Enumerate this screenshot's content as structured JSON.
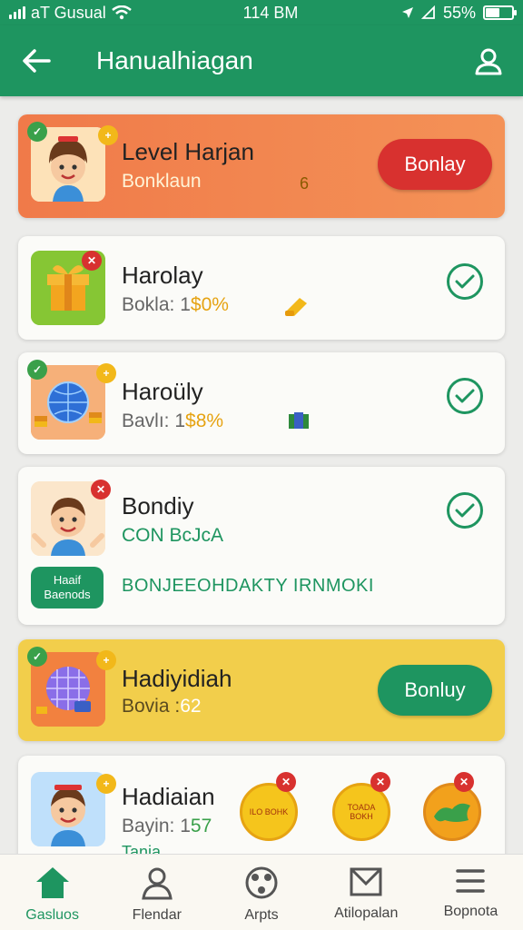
{
  "status_bar": {
    "carrier": "aT Gusual",
    "time": "114 BM",
    "battery": "55%",
    "battery_level": 0.55
  },
  "header": {
    "title": "Hanualhiagan",
    "back_icon": "arrow-left-icon",
    "profile_icon": "user-icon"
  },
  "cards": [
    {
      "title": "Level Harjan",
      "subtitle": "Bonklaun",
      "extra": "6",
      "action": "Bonlay",
      "style": "orange"
    },
    {
      "title": "Harolay",
      "subtitle_prefix": "Bokla: 1",
      "subtitle_value": "$0%",
      "status": "completed"
    },
    {
      "title": "Haroüly",
      "subtitle_prefix": "Bavlı: 1",
      "subtitle_value": "$8%",
      "status": "completed"
    },
    {
      "title": "Bondiy",
      "subtitle": "CON BcJcA",
      "tag_line1": "Haaif",
      "tag_line2": "Baenods",
      "tag_text": "BONJEEOHDAKTY IRNMOKI",
      "status": "completed"
    },
    {
      "title": "Hadiyidiah",
      "subtitle_prefix": "Bovia :",
      "subtitle_value": "62",
      "action": "Bonluy",
      "style": "yellow"
    },
    {
      "title": "Hadiaian",
      "subtitle_prefix": "Bayin: 1",
      "subtitle_value": "57",
      "footnote": "Tania",
      "reward_1": "ILO BOHK",
      "reward_2": "TOADA BOKH"
    }
  ],
  "tabs": [
    {
      "label": "Gasluos",
      "icon": "home-icon",
      "active": true
    },
    {
      "label": "Flendar",
      "icon": "person-icon",
      "active": false
    },
    {
      "label": "Arpts",
      "icon": "ball-icon",
      "active": false
    },
    {
      "label": "Atilopalan",
      "icon": "mail-icon",
      "active": false
    },
    {
      "label": "Bopnota",
      "icon": "menu-icon",
      "active": false
    }
  ],
  "colors": {
    "primary": "#1e9560",
    "orange_card": "#f07a49",
    "yellow_card": "#f2ce4b",
    "action_red": "#d8312f",
    "accent_gold": "#e6a312"
  }
}
